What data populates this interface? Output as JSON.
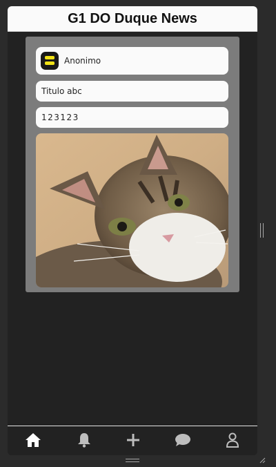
{
  "header": {
    "title": "G1 DO Duque News"
  },
  "post": {
    "author": {
      "name": "Anonimo",
      "avatar_icon": "server-icon",
      "avatar_accent": "#f1e217"
    },
    "title_value": "Titulo abc",
    "body_value": "123123",
    "image": {
      "subject": "tabby-cat-photo"
    }
  },
  "bottom_nav": {
    "items": [
      {
        "icon": "home-icon",
        "active": true
      },
      {
        "icon": "bell-icon",
        "active": false
      },
      {
        "icon": "plus-icon",
        "active": false
      },
      {
        "icon": "chat-icon",
        "active": false
      },
      {
        "icon": "user-icon",
        "active": false
      }
    ],
    "active_color": "#ffffff",
    "inactive_color": "#bdbdbd"
  }
}
